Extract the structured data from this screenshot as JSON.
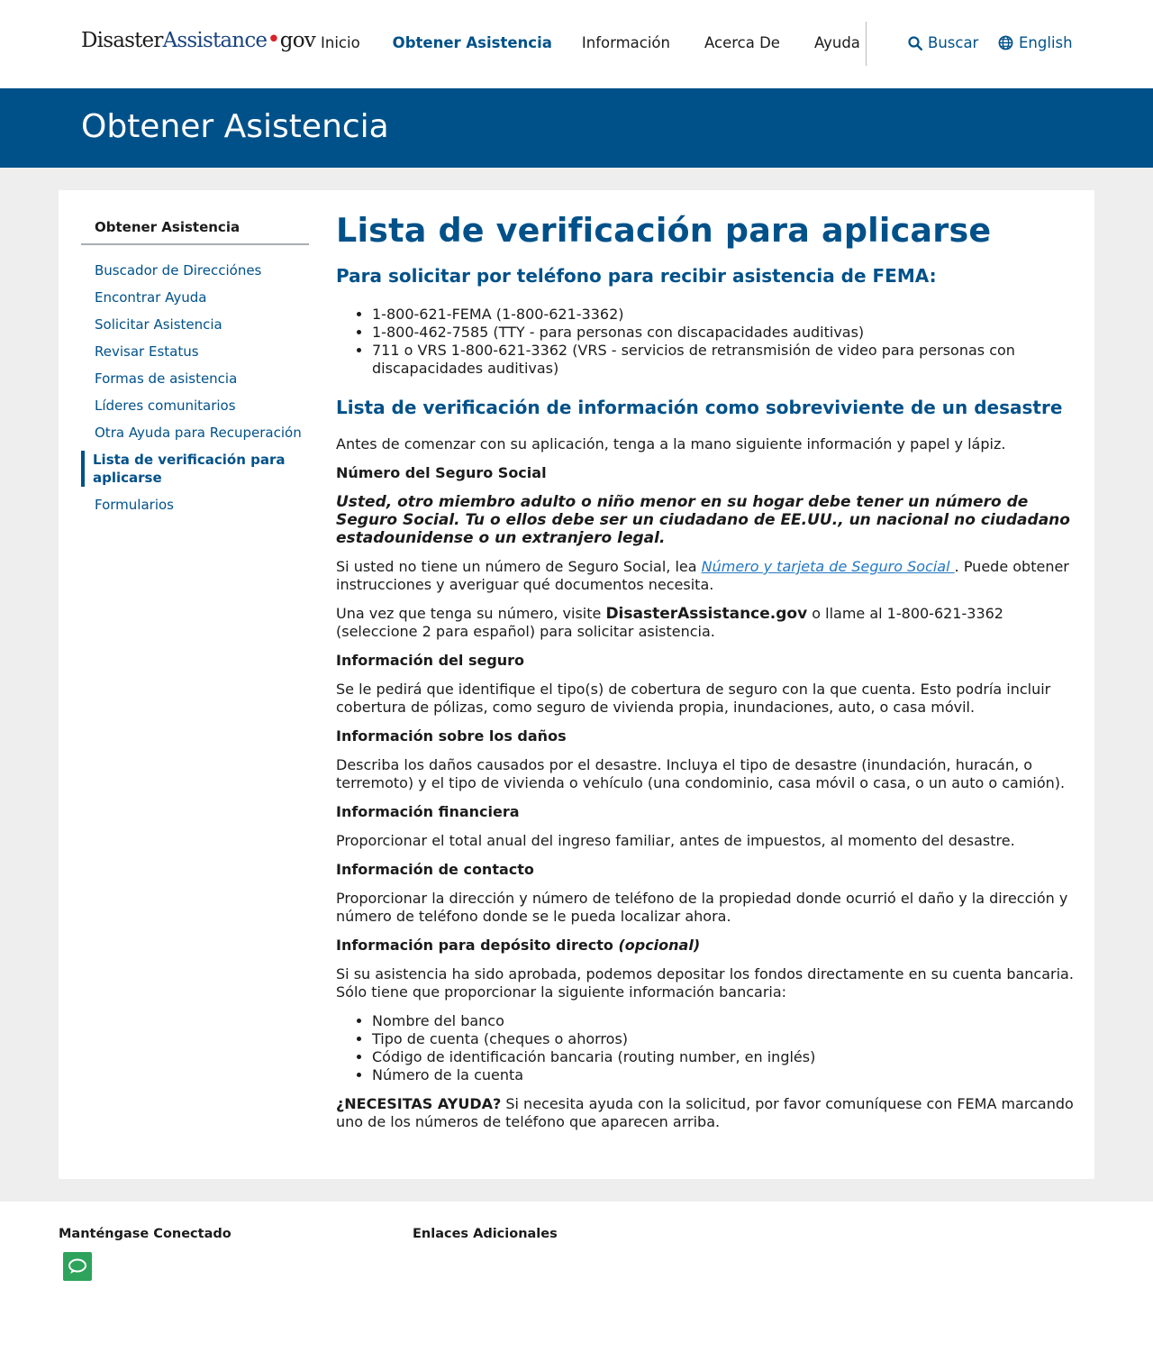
{
  "header": {
    "logo": {
      "part1": "Disaster",
      "part2": "Assistance",
      "dot": "•",
      "part3": "gov"
    },
    "nav": [
      {
        "label": "Inicio"
      },
      {
        "label": "Obtener Asistencia"
      },
      {
        "label": "Información"
      },
      {
        "label": "Acerca De"
      },
      {
        "label": "Ayuda"
      }
    ],
    "search_label": "Buscar",
    "language_label": "English"
  },
  "banner": {
    "title": "Obtener Asistencia"
  },
  "sidebar": {
    "heading": "Obtener Asistencia",
    "items": [
      {
        "label": "Buscador de Direcciónes"
      },
      {
        "label": "Encontrar Ayuda"
      },
      {
        "label": "Solicitar Asistencia"
      },
      {
        "label": "Revisar Estatus"
      },
      {
        "label": "Formas de asistencia"
      },
      {
        "label": "Líderes comunitarios"
      },
      {
        "label": "Otra Ayuda para Recuperación"
      },
      {
        "label": "Lista de verificación para aplicarse"
      },
      {
        "label": "Formularios"
      }
    ]
  },
  "article": {
    "title": "Lista de verificación para aplicarse",
    "phone_heading": "Para solicitar por teléfono para recibir asistencia de FEMA:",
    "phones": [
      "1-800-621-FEMA (1-800-621-3362)",
      "1-800-462-7585 (TTY - para personas con discapacidades auditivas)",
      "711 o VRS 1-800-621-3362 (VRS - servicios de retransmisión de video para personas con discapacidades auditivas)"
    ],
    "checklist_heading": "Lista de verificación de información como sobreviviente de un desastre",
    "intro": "Antes de comenzar con su aplicación, tenga a la mano siguiente información y papel y lápiz.",
    "ssn_heading": "Número del Seguro Social",
    "ssn_note": "Usted, otro miembro adulto o niño menor en su hogar debe tener un número de Seguro Social. Tu o ellos debe ser un ciudadano de EE.UU., un nacional no ciudadano estadounidense o un extranjero legal.",
    "ssn_p1_before": "Si usted no tiene un número de Seguro Social, lea ",
    "ssn_p1_link": "Número y tarjeta de Seguro Social ",
    "ssn_p1_after": ". Puede obtener instrucciones y averiguar qué documentos necesita.",
    "ssn_p2_before": "Una vez que tenga su número, visite ",
    "ssn_p2_bold": "DisasterAssistance.gov",
    "ssn_p2_after": " o llame al 1-800-621-3362 (seleccione 2 para español) para solicitar asistencia.",
    "insurance_heading": "Información del seguro",
    "insurance_text": "Se le pedirá que identifique el tipo(s) de cobertura de seguro con la que cuenta. Esto podría incluir cobertura de pólizas, como seguro de vivienda propia, inundaciones, auto, o casa móvil.",
    "damage_heading": "Información sobre los daños",
    "damage_text": "Describa los daños causados por el desastre. Incluya el tipo de desastre (inundación, huracán, o terremoto) y el tipo de vivienda o vehículo (una condominio, casa móvil o casa, o un auto o camión).",
    "financial_heading": "Información financiera",
    "financial_text": "Proporcionar el total anual del ingreso familiar, antes de impuestos, al momento del desastre.",
    "contact_heading": "Información de contacto",
    "contact_text": "Proporcionar la dirección y número de teléfono de la propiedad donde ocurrió el daño y la dirección y número de teléfono donde se le pueda localizar ahora.",
    "deposit_heading": "Información para depósito directo ",
    "deposit_optional": "(opcional)",
    "deposit_text": "Si su asistencia ha sido aprobada, podemos depositar los fondos directamente en su cuenta bancaria. Sólo tiene que proporcionar la siguiente información bancaria:",
    "bank_items": [
      "Nombre del banco",
      "Tipo de cuenta (cheques o ahorros)",
      "Código de identificación bancaria (routing number, en inglés)",
      "Número de la cuenta"
    ],
    "help_bold": "¿NECESITAS AYUDA?",
    "help_text": " Si necesita ayuda con la solicitud, por favor comuníquese con FEMA marcando uno de los números de teléfono que aparecen arriba."
  },
  "footer": {
    "connected_heading": "Manténgase Conectado",
    "links_heading": "Enlaces Adicionales"
  },
  "colors": {
    "primary": "#005189",
    "link": "#2378c3",
    "chat": "#2ea35c"
  }
}
